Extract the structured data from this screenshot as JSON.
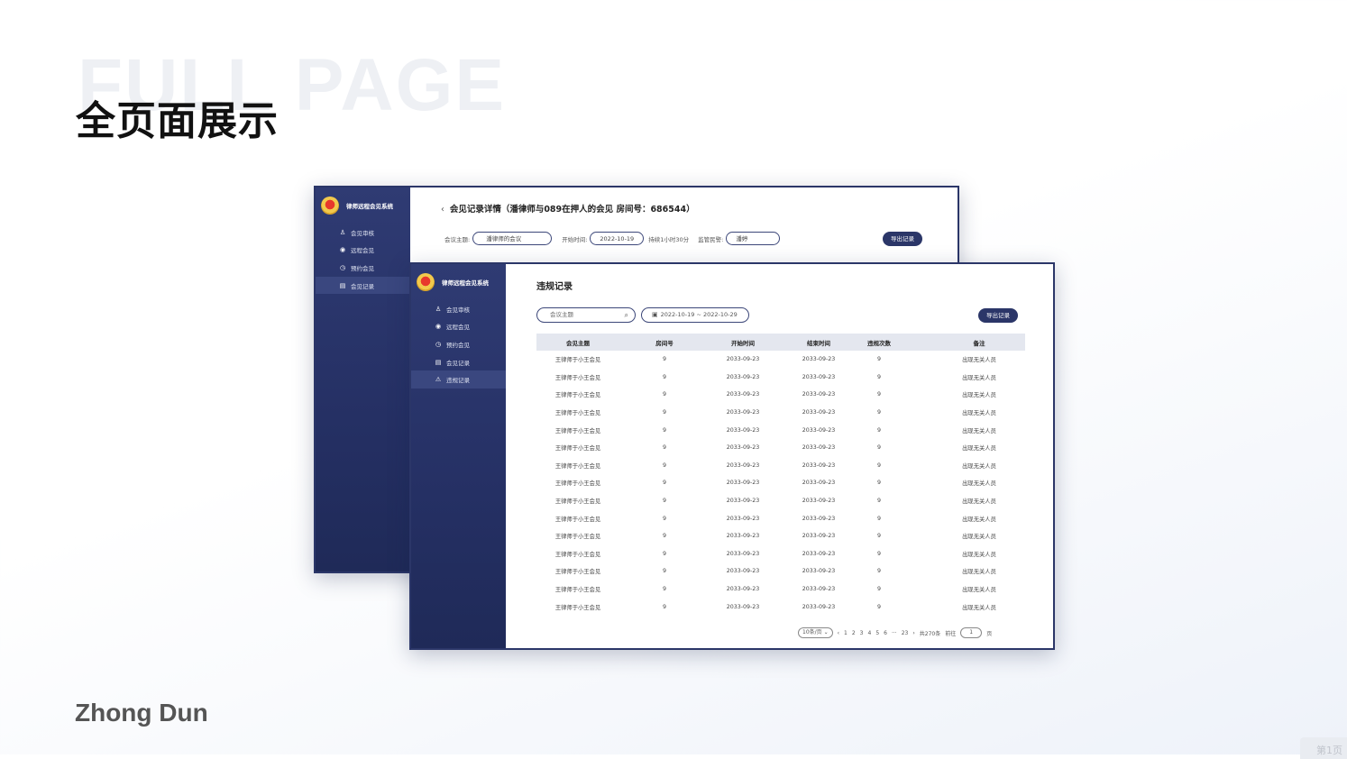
{
  "slide": {
    "bg_word": "FULL PAGE",
    "title": "全页面展示",
    "brand": "Zhong Dun",
    "page_tab": "第1页"
  },
  "app": {
    "system_name": "律师远程会见系统"
  },
  "back_screen": {
    "nav": [
      {
        "icon": "user-icon",
        "label": "会见审核",
        "active": false
      },
      {
        "icon": "location-icon",
        "label": "远程会见",
        "active": false
      },
      {
        "icon": "clock-icon",
        "label": "预约会见",
        "active": false
      },
      {
        "icon": "document-icon",
        "label": "会见记录",
        "active": true
      }
    ],
    "back": "‹",
    "title": "会见记录详情（潘律师与089在押人的会见 房间号：686544）",
    "filters": {
      "topic_label": "会议主题:",
      "topic_value": "潘律师的会议",
      "start_label": "开始时间:",
      "start_value": "2022-10-19",
      "duration": "持续1小时30分",
      "supervisor_label": "监管民警:",
      "supervisor_value": "潘婷"
    },
    "export": "导出记录"
  },
  "front_screen": {
    "nav": [
      {
        "icon": "user-icon",
        "label": "会见审核",
        "active": false
      },
      {
        "icon": "location-icon",
        "label": "远程会见",
        "active": false
      },
      {
        "icon": "clock-icon",
        "label": "预约会见",
        "active": false
      },
      {
        "icon": "document-icon",
        "label": "会见记录",
        "active": false
      },
      {
        "icon": "warning-icon",
        "label": "违规记录",
        "active": true
      }
    ],
    "title": "违规记录",
    "search_placeholder": "会议主题",
    "date_range": "2022-10-19 ~ 2022-10-29",
    "export": "导出记录",
    "columns": [
      "会见主题",
      "房间号",
      "开始时间",
      "结束时间",
      "违规次数",
      "备注"
    ],
    "rows": [
      [
        "王律师于小王会见",
        "9",
        "2033-09-23",
        "2033-09-23",
        "9",
        "出现无关人员"
      ],
      [
        "王律师于小王会见",
        "9",
        "2033-09-23",
        "2033-09-23",
        "9",
        "出现无关人员"
      ],
      [
        "王律师于小王会见",
        "9",
        "2033-09-23",
        "2033-09-23",
        "9",
        "出现无关人员"
      ],
      [
        "王律师于小王会见",
        "9",
        "2033-09-23",
        "2033-09-23",
        "9",
        "出现无关人员"
      ],
      [
        "王律师于小王会见",
        "9",
        "2033-09-23",
        "2033-09-23",
        "9",
        "出现无关人员"
      ],
      [
        "王律师于小王会见",
        "9",
        "2033-09-23",
        "2033-09-23",
        "9",
        "出现无关人员"
      ],
      [
        "王律师于小王会见",
        "9",
        "2033-09-23",
        "2033-09-23",
        "9",
        "出现无关人员"
      ],
      [
        "王律师于小王会见",
        "9",
        "2033-09-23",
        "2033-09-23",
        "9",
        "出现无关人员"
      ],
      [
        "王律师于小王会见",
        "9",
        "2033-09-23",
        "2033-09-23",
        "9",
        "出现无关人员"
      ],
      [
        "王律师于小王会见",
        "9",
        "2033-09-23",
        "2033-09-23",
        "9",
        "出现无关人员"
      ],
      [
        "王律师于小王会见",
        "9",
        "2033-09-23",
        "2033-09-23",
        "9",
        "出现无关人员"
      ],
      [
        "王律师于小王会见",
        "9",
        "2033-09-23",
        "2033-09-23",
        "9",
        "出现无关人员"
      ],
      [
        "王律师于小王会见",
        "9",
        "2033-09-23",
        "2033-09-23",
        "9",
        "出现无关人员"
      ],
      [
        "王律师于小王会见",
        "9",
        "2033-09-23",
        "2033-09-23",
        "9",
        "出现无关人员"
      ],
      [
        "王律师于小王会见",
        "9",
        "2033-09-23",
        "2033-09-23",
        "9",
        "出现无关人员"
      ]
    ],
    "pager": {
      "page_size": "10条/页 ⌄",
      "prev": "‹",
      "pages": [
        "1",
        "2",
        "3",
        "4",
        "5",
        "6",
        "···",
        "23"
      ],
      "next": "›",
      "total": "共270条",
      "goto": "前往",
      "current": "1",
      "page_suffix": "页"
    }
  }
}
